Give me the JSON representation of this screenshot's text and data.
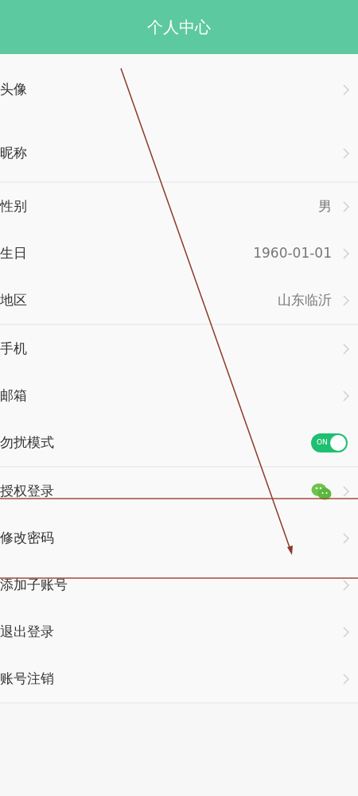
{
  "header": {
    "title": "个人中心"
  },
  "groups": [
    [
      {
        "kind": "avatar",
        "label": "头像"
      },
      {
        "kind": "link",
        "label": "昵称"
      }
    ],
    [
      {
        "kind": "value",
        "label": "性别",
        "value": "男"
      },
      {
        "kind": "value",
        "label": "生日",
        "value": "1960-01-01"
      },
      {
        "kind": "value",
        "label": "地区",
        "value": "山东临沂"
      }
    ],
    [
      {
        "kind": "link",
        "label": "手机"
      },
      {
        "kind": "link",
        "label": "邮箱"
      },
      {
        "kind": "toggle",
        "label": "勿扰模式",
        "on": true,
        "toggle_text": "ON"
      }
    ],
    [
      {
        "kind": "wechat",
        "label": "授权登录"
      },
      {
        "kind": "link",
        "label": "修改密码"
      },
      {
        "kind": "link",
        "label": "添加子账号"
      },
      {
        "kind": "link",
        "label": "退出登录"
      },
      {
        "kind": "link",
        "label": "账号注销"
      }
    ]
  ]
}
